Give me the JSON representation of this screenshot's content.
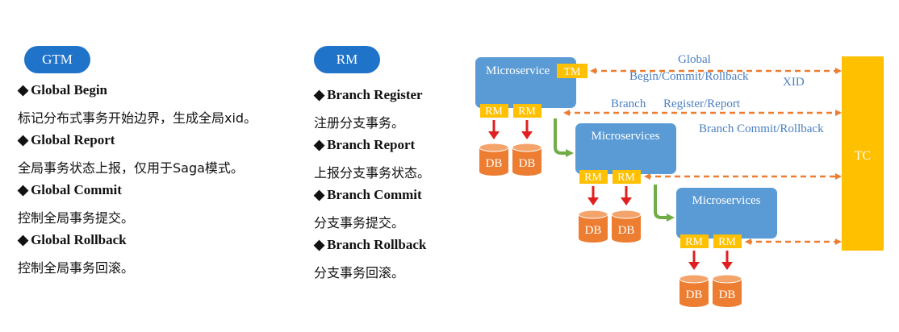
{
  "gtm": {
    "badge": "GTM",
    "items": [
      {
        "title": "Global Begin",
        "desc": "标记分布式事务开始边界，生成全局xid。"
      },
      {
        "title": "Global Report",
        "desc": "全局事务状态上报，仅用于Saga模式。"
      },
      {
        "title": "Global Commit",
        "desc": "控制全局事务提交。"
      },
      {
        "title": "Global Rollback",
        "desc": "控制全局事务回滚。"
      }
    ]
  },
  "rm": {
    "badge": "RM",
    "items": [
      {
        "title": "Branch Register",
        "desc": "注册分支事务。"
      },
      {
        "title": "Branch Report",
        "desc": "上报分支事务状态。"
      },
      {
        "title": "Branch Commit",
        "desc": "分支事务提交。"
      },
      {
        "title": "Branch Rollback",
        "desc": "分支事务回滚。"
      }
    ]
  },
  "diagram": {
    "bullet": "◆",
    "tc": "TC",
    "tm": "TM",
    "rm": "RM",
    "db": "DB",
    "microservices_first": "Microservice",
    "microservices": "Microservices",
    "label_global": "Global",
    "label_begin_commit": "Begin/Commit/Rollback",
    "label_xid": "XID",
    "label_branch": "Branch",
    "label_register_report": "Register/Report",
    "label_branch_commit": "Branch Commit/Rollback"
  },
  "colors": {
    "badge_blue": "#1f73c9",
    "service_blue": "#5b9bd5",
    "tc_gold": "#ffc000",
    "tag_gold": "#ffc000",
    "db_orange": "#ed7d31",
    "dashed_orange": "#ed7d31",
    "red_arrow": "#e02020",
    "green_arrow": "#70ad47",
    "label_blue": "#4a7fc1"
  }
}
